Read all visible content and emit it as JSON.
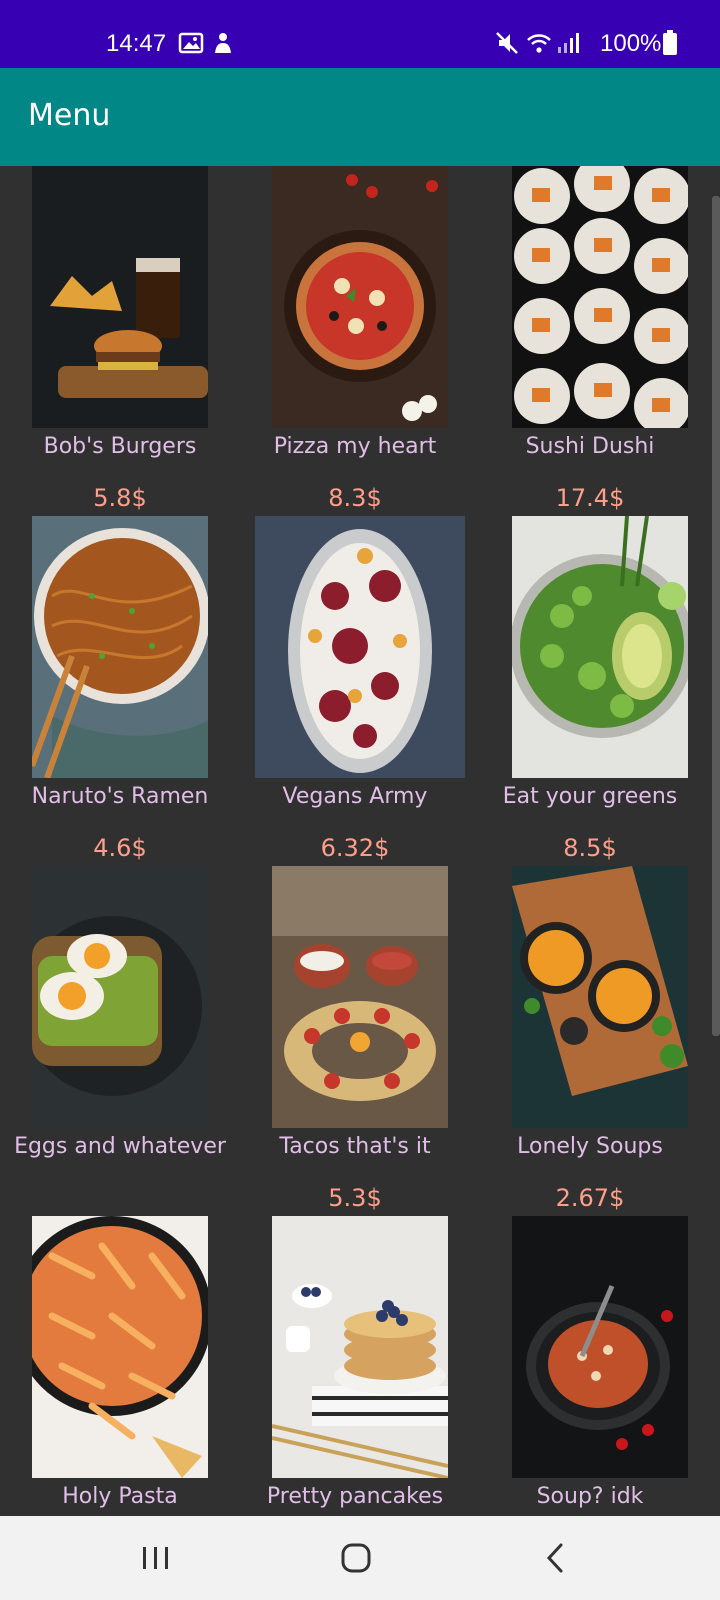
{
  "status_bar": {
    "time": "14:47",
    "battery": "100%",
    "icons": [
      "gallery-icon",
      "notification-icon",
      "mute-icon",
      "wifi-icon",
      "signal-icon",
      "battery-icon"
    ]
  },
  "app_bar": {
    "title": "Menu",
    "color": "#018786"
  },
  "theme": {
    "status_bar_color": "#3700b3",
    "background": "#303030",
    "name_color": "#e1bee7",
    "price_color": "#ff9e8a"
  },
  "menu": {
    "items": [
      {
        "name": "Bob's Burgers",
        "price": "5.8$",
        "image": "burger-photo"
      },
      {
        "name": "Pizza my heart",
        "price": "8.3$",
        "image": "pizza-photo"
      },
      {
        "name": "Sushi Dushi",
        "price": "17.4$",
        "image": "sushi-photo"
      },
      {
        "name": "Naruto's Ramen",
        "price": "4.6$",
        "image": "ramen-photo"
      },
      {
        "name": "Vegans Army",
        "price": "6.32$",
        "image": "vegan-platter-photo"
      },
      {
        "name": "Eat your greens",
        "price": "8.5$",
        "image": "greens-bowl-photo"
      },
      {
        "name": "Eggs and whatever",
        "price": "",
        "image": "eggs-avocado-photo"
      },
      {
        "name": "Tacos that's it",
        "price": "5.3$",
        "image": "tacos-photo"
      },
      {
        "name": "Lonely Soups",
        "price": "2.67$",
        "image": "soups-photo"
      },
      {
        "name": "Holy Pasta",
        "price": "",
        "image": "pasta-photo"
      },
      {
        "name": "Pretty pancakes",
        "price": "",
        "image": "pancakes-photo"
      },
      {
        "name": "Soup? idk",
        "price": "",
        "image": "tomato-soup-photo"
      }
    ]
  },
  "nav_bar": {
    "buttons": [
      "recents-button",
      "home-button",
      "back-button"
    ]
  }
}
